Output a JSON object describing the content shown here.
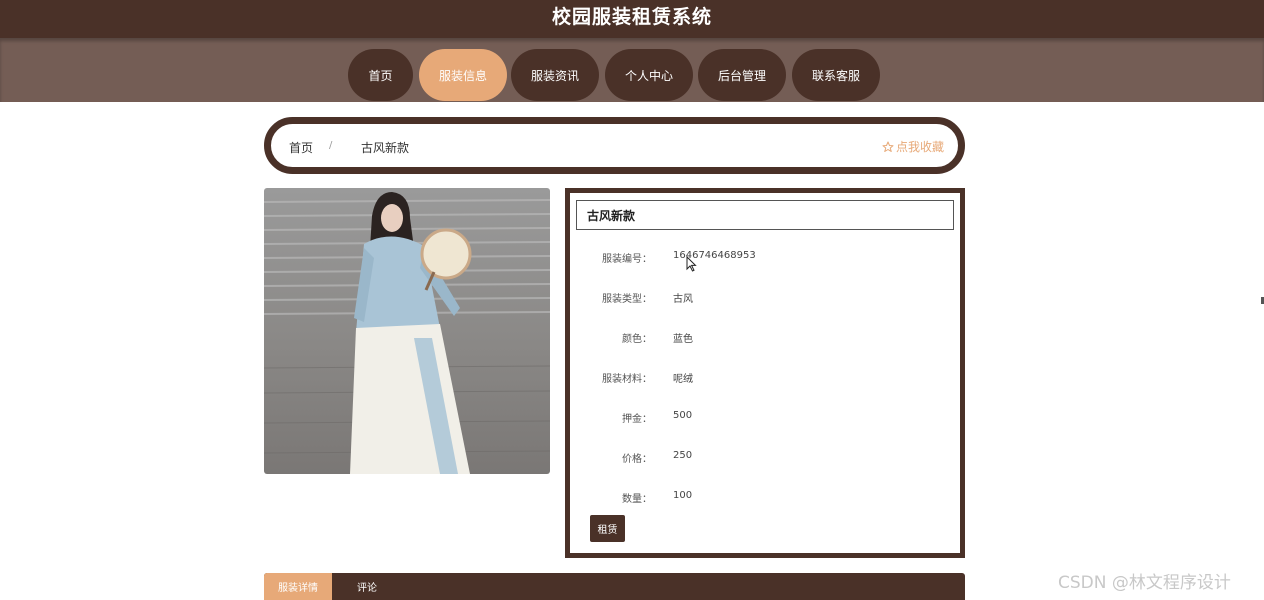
{
  "header": {
    "title": "校园服装租赁系统"
  },
  "nav": {
    "items": [
      {
        "label": "首页"
      },
      {
        "label": "服装信息"
      },
      {
        "label": "服装资讯"
      },
      {
        "label": "个人中心"
      },
      {
        "label": "后台管理"
      },
      {
        "label": "联系客服"
      }
    ],
    "active_index": 1
  },
  "breadcrumb": {
    "home": "首页",
    "separator": "/",
    "current": "古风新款"
  },
  "favorite": {
    "label": "点我收藏",
    "icon": "star-outline-icon"
  },
  "product": {
    "image": "hanfu-photo",
    "title": "古风新款",
    "fields": [
      {
        "label": "服装编号：",
        "value": "1646746468953"
      },
      {
        "label": "服装类型：",
        "value": "古风"
      },
      {
        "label": "颜色：",
        "value": "蓝色"
      },
      {
        "label": "服装材料：",
        "value": "呢绒"
      },
      {
        "label": "押金：",
        "value": "500"
      },
      {
        "label": "价格：",
        "value": "250"
      },
      {
        "label": "数量：",
        "value": "100"
      }
    ],
    "rent_button": "租赁"
  },
  "tabs": [
    {
      "label": "服装详情"
    },
    {
      "label": "评论"
    }
  ],
  "watermark": "CSDN @林文程序设计",
  "colors": {
    "primary": "#4a3128",
    "nav_bg": "#745d55",
    "accent": "#e7a978"
  }
}
